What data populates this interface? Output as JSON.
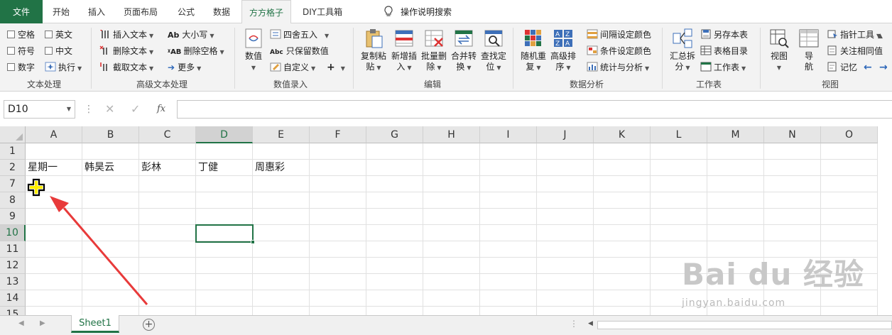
{
  "tabs": {
    "file": "文件",
    "home": "开始",
    "insert": "插入",
    "page_layout": "页面布局",
    "formulas": "公式",
    "data": "数据",
    "fangfang": "方方格子",
    "diy": "DIY工具箱",
    "tell_me": "操作说明搜索"
  },
  "ribbon": {
    "text_group": {
      "label": "文本处理",
      "space": "空格",
      "english": "英文",
      "symbol": "符号",
      "chinese": "中文",
      "number": "数字",
      "execute": "执行"
    },
    "adv_text": {
      "label": "高级文本处理",
      "insert_text": "插入文本",
      "delete_text": "删除文本",
      "extract_text": "截取文本",
      "case": "大小写",
      "delete_space": "删除空格",
      "more": "更多",
      "icon_ab": "Ab",
      "icon_abc": "Abc",
      "icon_xab": "ᵡAB"
    },
    "num_entry": {
      "label": "数值录入",
      "numeric": "数值",
      "round": "四舍五入",
      "keep_value": "只保留数值",
      "custom": "自定义"
    },
    "edit": {
      "label": "编辑",
      "copy_paste": [
        "复制粘",
        "贴"
      ],
      "add_insert": [
        "新增插",
        "入"
      ],
      "batch_delete": [
        "批量删",
        "除"
      ],
      "merge_convert": [
        "合并转",
        "换"
      ],
      "find_locate": [
        "查找定",
        "位"
      ]
    },
    "analysis": {
      "label": "数据分析",
      "random": [
        "随机重",
        "复"
      ],
      "sort": [
        "高级排",
        "序"
      ],
      "interval_color": "间隔设定颜色",
      "cond_color": "条件设定颜色",
      "stats": "统计与分析"
    },
    "worksheet": {
      "label": "工作表",
      "summary": [
        "汇总拆",
        "分"
      ],
      "save_as": "另存本表",
      "table_dir": "表格目录",
      "sheet": "工作表"
    },
    "view": {
      "label": "视图",
      "view": "视图",
      "nav": [
        "导",
        "航"
      ],
      "pointer": "指针工具",
      "watch_same": "关注相同值",
      "memo": "记忆"
    }
  },
  "formula_bar": {
    "name_box": "D10",
    "fx": "fx",
    "value": ""
  },
  "columns": [
    "A",
    "B",
    "C",
    "D",
    "E",
    "F",
    "G",
    "H",
    "I",
    "J",
    "K",
    "L",
    "M",
    "N",
    "O"
  ],
  "selected_column": "D",
  "rows": [
    {
      "num": "1",
      "cells": [
        "",
        "",
        "",
        "",
        ""
      ]
    },
    {
      "num": "2",
      "cells": [
        "星期一",
        "韩昊云",
        "彭林",
        "丁健",
        "周惠彩"
      ]
    },
    {
      "num": "7",
      "cells": [
        "",
        "",
        "",
        "",
        ""
      ]
    },
    {
      "num": "8",
      "cells": [
        "",
        "",
        "",
        "",
        ""
      ]
    },
    {
      "num": "9",
      "cells": [
        "",
        "",
        "",
        "",
        ""
      ]
    },
    {
      "num": "10",
      "cells": [
        "",
        "",
        "",
        "",
        ""
      ]
    },
    {
      "num": "11",
      "cells": [
        "",
        "",
        "",
        "",
        ""
      ]
    },
    {
      "num": "12",
      "cells": [
        "",
        "",
        "",
        "",
        ""
      ]
    },
    {
      "num": "13",
      "cells": [
        "",
        "",
        "",
        "",
        ""
      ]
    },
    {
      "num": "14",
      "cells": [
        "",
        "",
        "",
        "",
        ""
      ]
    },
    {
      "num": "15",
      "cells": [
        "",
        "",
        "",
        "",
        ""
      ]
    }
  ],
  "selected_row": "10",
  "sheets": [
    "Sheet1"
  ],
  "add_sheet": "⊕",
  "watermark": {
    "main": "Bai du 经验",
    "sub": "jingyan.baidu.com"
  },
  "colors": {
    "accent": "#217346",
    "arrow": "#e83a3a"
  }
}
